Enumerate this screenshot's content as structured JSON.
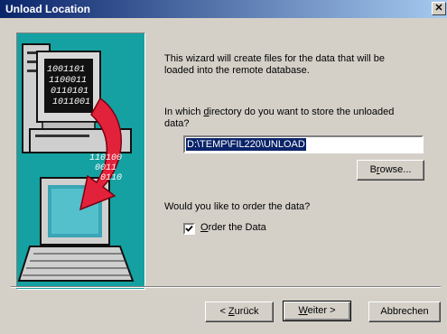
{
  "window": {
    "title": "Unload Location",
    "close_glyph": "✕"
  },
  "wizard": {
    "intro_line1": "This wizard will create files for the data that will be",
    "intro_line2": "loaded into the remote database.",
    "dir_q_pre": "In which ",
    "dir_q_accel": "d",
    "dir_q_post": "irectory do you want to store the unloaded",
    "dir_q_line2": "data?",
    "directory_value": "D:\\TEMP\\FIL220\\UNLOAD",
    "browse_pre": "B",
    "browse_accel": "r",
    "browse_post": "owse...",
    "order_question": "Would you like to order the data?",
    "order_checked": true,
    "order_accel": "O",
    "order_label_rest": "rder the Data"
  },
  "buttons": {
    "back_pre": "< ",
    "back_accel": "Z",
    "back_post": "urück",
    "next_accel": "W",
    "next_post": "eiter >",
    "cancel": "Abbrechen"
  },
  "illustration": {
    "icons": [
      "desktop-computer-icon",
      "laptop-icon",
      "binary-data-arrow-icon"
    ],
    "binary_top": [
      "1001101",
      "1100011",
      "0110101",
      "1011001"
    ],
    "binary_bottom": [
      "110100",
      "0011",
      "0110"
    ],
    "colors": {
      "background": "#15a1a1",
      "arrow": "#e2213a"
    }
  },
  "colors": {
    "dialog_bg": "#d4d0c8",
    "titlebar_start": "#0a246a",
    "titlebar_end": "#a6caf0",
    "selection": "#0a246a"
  }
}
